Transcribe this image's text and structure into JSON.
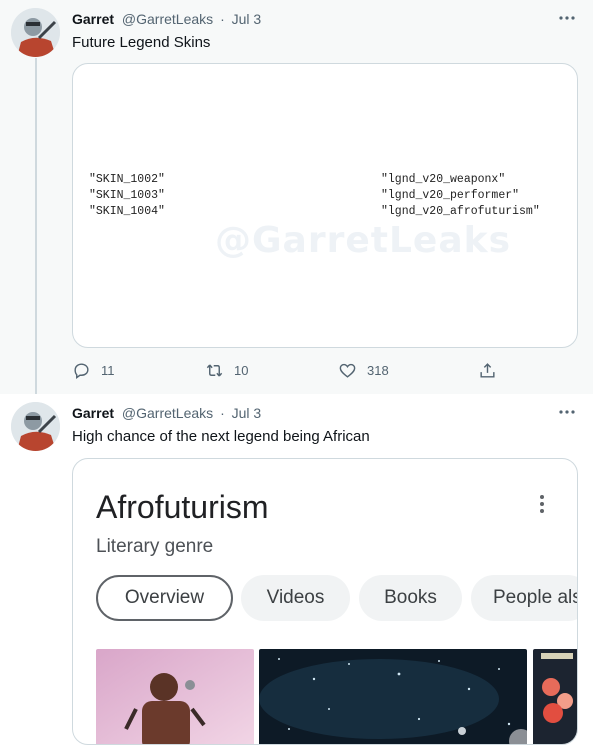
{
  "tweets": [
    {
      "author_name": "Garret",
      "author_handle": "@GarretLeaks",
      "separator": "·",
      "date": "Jul 3",
      "text": "Future Legend Skins",
      "media": {
        "code_left": "\"SKIN_1002\"\n\"SKIN_1003\"\n\"SKIN_1004\"",
        "code_right": "\"lgnd_v20_weaponx\"\n\"lgnd_v20_performer\"\n\"lgnd_v20_afrofuturism\"",
        "watermark": "@GarretLeaks"
      },
      "actions": {
        "replies": "11",
        "retweets": "10",
        "likes": "318"
      }
    },
    {
      "author_name": "Garret",
      "author_handle": "@GarretLeaks",
      "separator": "·",
      "date": "Jul 3",
      "text": "High chance of the next legend being African",
      "media": {
        "title": "Afrofuturism",
        "subtitle": "Literary genre",
        "chips": [
          "Overview",
          "Videos",
          "Books",
          "People als"
        ]
      }
    }
  ],
  "colors": {
    "text_primary": "#0f1419",
    "text_secondary": "#536471",
    "border": "#cfd9de",
    "selected_tweet_bg": "#f7f9f9"
  },
  "icons": [
    "more-icon",
    "reply-icon",
    "retweet-icon",
    "like-icon",
    "share-icon"
  ]
}
